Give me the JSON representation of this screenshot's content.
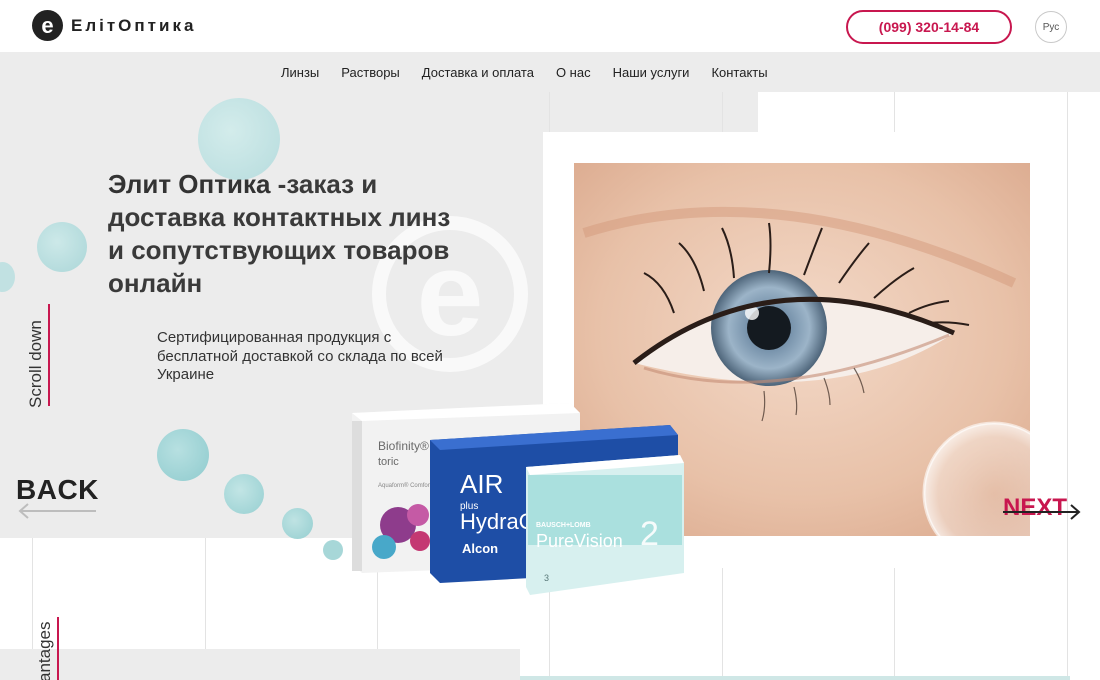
{
  "brand": {
    "logo_letter": "e",
    "name": "ЕлітОптика"
  },
  "header": {
    "phone": "(099) 320-14-84",
    "language": "Рус"
  },
  "nav": {
    "items": [
      "Линзы",
      "Растворы",
      "Доставка и оплата",
      "О нас",
      "Наши услуги",
      "Контакты"
    ]
  },
  "hero": {
    "title_bold": "Элит Оптика",
    "title_rest": " -заказ и доставка контактных линз и сопутствующих товаров онлайн",
    "subtitle": "Сертифицированная продукция с бесплатной доставкой со склада  по всей Украине",
    "watermark_letter": "e"
  },
  "side": {
    "scroll_label": "Scroll down",
    "advantages_label": "antages"
  },
  "slider": {
    "back_label": "BACK",
    "next_label": "NEXT"
  },
  "products": {
    "box1": {
      "name": "Biofinity®",
      "variant": "toric",
      "small": "Aquaform® Comfort"
    },
    "box2": {
      "name_line1": "AIR",
      "name_line2": "plus",
      "name_line3": "HydraG",
      "maker": "Alcon"
    },
    "box3": {
      "maker": "BAUSCH+LOMB",
      "name": "PureVision",
      "number": "2",
      "count": "3"
    }
  },
  "colors": {
    "accent": "#c8174f",
    "bubble": "#9fd5d8",
    "gray_bg": "#ececec"
  }
}
